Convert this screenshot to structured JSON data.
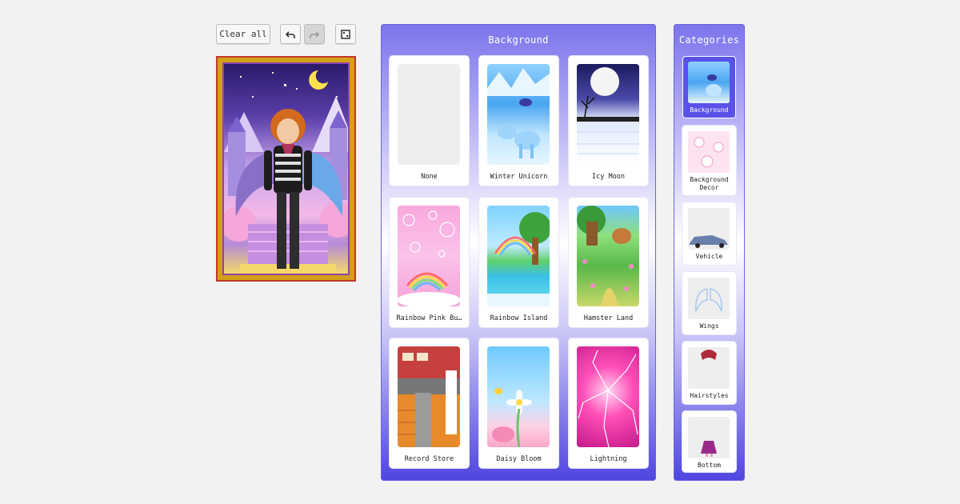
{
  "toolbar": {
    "clear_all_label": "Clear all",
    "undo_icon": "undo-icon",
    "redo_icon": "redo-icon",
    "random_icon": "dice-icon"
  },
  "background_panel": {
    "title": "Background",
    "items": [
      {
        "label": "None",
        "theme": "none"
      },
      {
        "label": "Winter Unicorn",
        "theme": "ice"
      },
      {
        "label": "Icy Moon",
        "theme": "moon"
      },
      {
        "label": "Rainbow Pink Bu…",
        "theme": "pink"
      },
      {
        "label": "Rainbow Island",
        "theme": "island"
      },
      {
        "label": "Hamster Land",
        "theme": "forest"
      },
      {
        "label": "Record Store",
        "theme": "store"
      },
      {
        "label": "Daisy Bloom",
        "theme": "daisy"
      },
      {
        "label": "Lightning",
        "theme": "lightning"
      }
    ]
  },
  "categories_panel": {
    "title": "Categories",
    "items": [
      {
        "label_lines": [
          "Background"
        ],
        "active": true
      },
      {
        "label_lines": [
          "Background",
          "Decor"
        ],
        "active": false
      },
      {
        "label_lines": [
          "Vehicle"
        ],
        "active": false
      },
      {
        "label_lines": [
          "Wings"
        ],
        "active": false
      },
      {
        "label_lines": [
          "Hairstyles"
        ],
        "active": false
      },
      {
        "label_lines": [
          "Bottom"
        ],
        "active": false
      }
    ]
  },
  "colors": {
    "panel_top": "#7b74ec",
    "panel_bottom": "#4e45e0",
    "active_category": "#5a52e8",
    "frame_gold": "#d4a017"
  }
}
